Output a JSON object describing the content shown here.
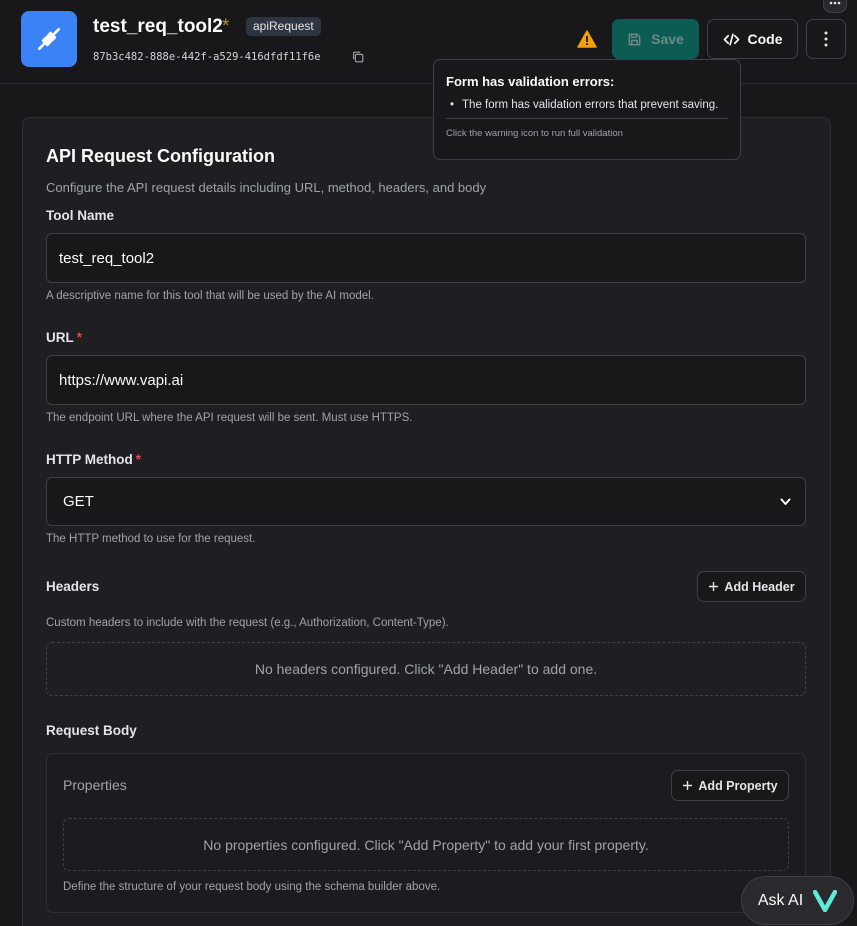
{
  "header": {
    "title": "test_req_tool2",
    "unsaved_marker": "*",
    "type_badge": "apiRequest",
    "tool_id": "87b3c482-888e-442f-a529-416dfdf11f6e",
    "save_label": "Save",
    "code_label": "Code"
  },
  "tooltip": {
    "title": "Form has validation errors:",
    "item": "The form has validation errors that prevent saving.",
    "hint": "Click the warning icon to run full validation"
  },
  "form": {
    "title": "API Request Configuration",
    "description": "Configure the API request details including URL, method, headers, and body",
    "tool_name": {
      "label": "Tool Name",
      "value": "test_req_tool2",
      "help": "A descriptive name for this tool that will be used by the AI model."
    },
    "url": {
      "label": "URL",
      "required": "*",
      "value": "https://www.vapi.ai",
      "help": "The endpoint URL where the API request will be sent. Must use HTTPS."
    },
    "method": {
      "label": "HTTP Method",
      "required": "*",
      "value": "GET",
      "help": "The HTTP method to use for the request."
    },
    "headers": {
      "label": "Headers",
      "add_label": "Add Header",
      "help": "Custom headers to include with the request (e.g., Authorization, Content-Type).",
      "empty": "No headers configured. Click \"Add Header\" to add one."
    },
    "body": {
      "label": "Request Body",
      "properties_label": "Properties",
      "add_label": "Add Property",
      "empty": "No properties configured. Click \"Add Property\" to add your first property.",
      "help": "Define the structure of your request body using the schema builder above."
    }
  },
  "ask_ai": {
    "label": "Ask AI"
  },
  "colors": {
    "accent": "#3b82f6",
    "save": "#0d5c53",
    "warning": "#f59e0b",
    "required": "#ef4444",
    "vapi": "#5eead4"
  }
}
